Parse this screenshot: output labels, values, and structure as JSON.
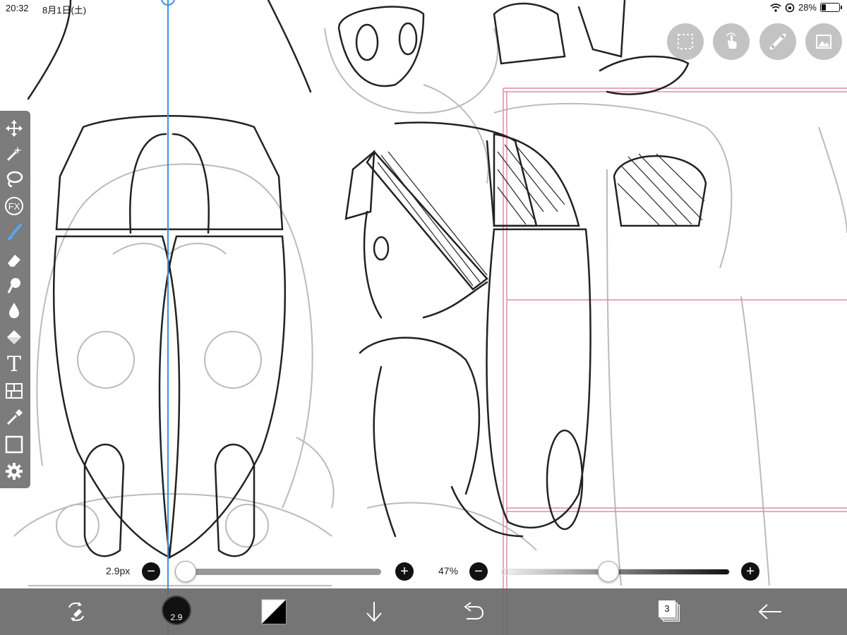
{
  "status_bar": {
    "time": "20:32",
    "date": "8月1日(土)",
    "battery_percent": "28%",
    "battery_level": 0.28
  },
  "toolbar": {
    "tools": [
      {
        "name": "move-tool",
        "icon": "move-arrows-icon"
      },
      {
        "name": "magic-wand-tool",
        "icon": "magic-wand-icon"
      },
      {
        "name": "lasso-tool",
        "icon": "lasso-icon"
      },
      {
        "name": "filter-tool",
        "icon": "fx-icon",
        "label": "FX"
      },
      {
        "name": "brush-tool",
        "icon": "brush-icon"
      },
      {
        "name": "eraser-tool",
        "icon": "eraser-icon"
      },
      {
        "name": "smudge-tool",
        "icon": "smudge-icon"
      },
      {
        "name": "blur-tool",
        "icon": "droplet-icon"
      },
      {
        "name": "fill-tool",
        "icon": "bucket-icon"
      },
      {
        "name": "text-tool",
        "icon": "text-icon",
        "label": "T"
      },
      {
        "name": "frame-divider-tool",
        "icon": "panel-icon"
      },
      {
        "name": "eyedropper-tool",
        "icon": "eyedropper-icon"
      },
      {
        "name": "canvas-tool",
        "icon": "canvas-icon"
      },
      {
        "name": "settings-tool",
        "icon": "gear-icon"
      }
    ]
  },
  "top_buttons": [
    {
      "name": "selection-button",
      "icon": "selection-icon"
    },
    {
      "name": "gesture-button",
      "icon": "hand-tap-icon"
    },
    {
      "name": "ruler-button",
      "icon": "ruler-icon"
    },
    {
      "name": "reference-button",
      "icon": "image-icon"
    }
  ],
  "brush_size_slider": {
    "label": "2.9px",
    "value_fraction": 0.05
  },
  "opacity_slider": {
    "label": "47%",
    "value_fraction": 0.47
  },
  "bottom_bar": {
    "brush_size_text": "2.9",
    "layer_count": "3",
    "icons": [
      "transform-icon",
      "brush-size-icon",
      "color-swatch-icon",
      "download-icon",
      "undo-icon",
      "layers-icon",
      "back-arrow-icon"
    ]
  },
  "colors": {
    "guide_line": "#3f8fe0",
    "frame_border": "#e38aa8",
    "ui_gray": "#6e6e6e"
  }
}
